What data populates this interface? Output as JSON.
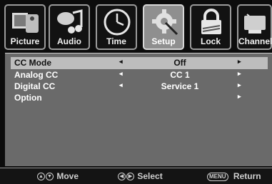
{
  "tabs": [
    {
      "label": "Picture",
      "icon": "picture-icon"
    },
    {
      "label": "Audio",
      "icon": "audio-icon"
    },
    {
      "label": "Time",
      "icon": "clock-icon"
    },
    {
      "label": "Setup",
      "icon": "gear-icon",
      "active": true
    },
    {
      "label": "Lock",
      "icon": "lock-icon"
    },
    {
      "label": "Channel",
      "icon": "satellite-dish-icon"
    }
  ],
  "rows": [
    {
      "name": "CC Mode",
      "left_arrow": "◂",
      "value": "Off",
      "right_arrow": "▸",
      "selected": true
    },
    {
      "name": "Analog CC",
      "left_arrow": "◂",
      "value": "CC 1",
      "right_arrow": "▸"
    },
    {
      "name": "Digital CC",
      "left_arrow": "◂",
      "value": "Service 1",
      "right_arrow": "▸"
    },
    {
      "name": "Option",
      "left_arrow": "",
      "value": "",
      "right_arrow": "▸"
    }
  ],
  "footer": {
    "move_label": "Move",
    "select_label": "Select",
    "return_button": "MENU",
    "return_label": "Return"
  }
}
